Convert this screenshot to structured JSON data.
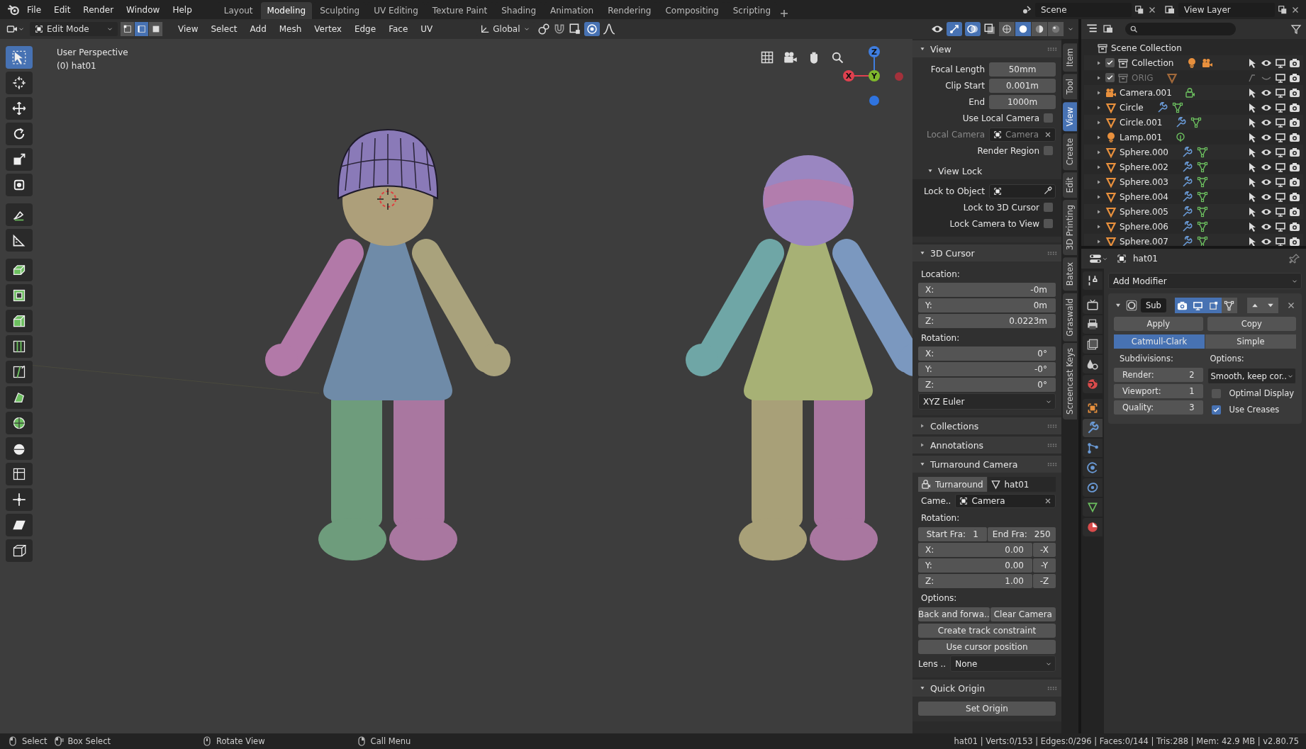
{
  "menubar": {
    "menus": [
      "File",
      "Edit",
      "Render",
      "Window",
      "Help"
    ],
    "workspaces": [
      {
        "label": "Layout",
        "selected": false
      },
      {
        "label": "Modeling",
        "selected": true
      },
      {
        "label": "Sculpting",
        "selected": false
      },
      {
        "label": "UV Editing",
        "selected": false
      },
      {
        "label": "Texture Paint",
        "selected": false
      },
      {
        "label": "Shading",
        "selected": false
      },
      {
        "label": "Animation",
        "selected": false
      },
      {
        "label": "Rendering",
        "selected": false
      },
      {
        "label": "Compositing",
        "selected": false
      },
      {
        "label": "Scripting",
        "selected": false
      }
    ],
    "scene": "Scene",
    "view_layer": "View Layer"
  },
  "header": {
    "mode": "Edit Mode",
    "select_modes": [
      {
        "selected": false
      },
      {
        "selected": true
      },
      {
        "selected": false
      }
    ],
    "menus": [
      "View",
      "Select",
      "Add",
      "Mesh",
      "Vertex",
      "Edge",
      "Face",
      "UV"
    ],
    "orientation": "Global",
    "shading": [
      {
        "selected": false
      },
      {
        "selected": true
      },
      {
        "selected": false
      },
      {
        "selected": false
      }
    ]
  },
  "viewport": {
    "view_name": "User Perspective",
    "object_info": "(0) hat01",
    "gizmo": [
      "Z",
      "X",
      "Y"
    ]
  },
  "toolbar": {
    "tools": [
      {
        "selected": true
      },
      {
        "selected": false
      },
      {
        "selected": false
      },
      {
        "selected": false
      },
      {
        "selected": false
      },
      {
        "selected": false
      },
      {
        "selected": false
      },
      {
        "selected": false
      },
      {
        "selected": false
      },
      {
        "selected": false
      },
      {
        "selected": false
      },
      {
        "selected": false
      },
      {
        "selected": false
      },
      {
        "selected": false
      },
      {
        "selected": false
      },
      {
        "selected": false
      },
      {
        "selected": false
      },
      {
        "selected": false
      },
      {
        "selected": false
      },
      {
        "selected": false
      }
    ]
  },
  "sidebar": {
    "tabs": [
      {
        "label": "Item",
        "selected": false
      },
      {
        "label": "Tool",
        "selected": false
      },
      {
        "label": "View",
        "selected": true
      },
      {
        "label": "Create",
        "selected": false
      },
      {
        "label": "Edit",
        "selected": false
      },
      {
        "label": "3D Printing",
        "selected": false
      },
      {
        "label": "Batex",
        "selected": false
      },
      {
        "label": "Graswald",
        "selected": false
      },
      {
        "label": "Screencast Keys",
        "selected": false
      }
    ],
    "panels": [
      {
        "title": "View",
        "expanded": true,
        "rows": [
          {
            "kind": "prop",
            "label": "Focal Length",
            "value": "50mm"
          },
          {
            "kind": "prop",
            "label": "Clip Start",
            "value": "0.001m"
          },
          {
            "kind": "prop",
            "label": "End",
            "value": "1000m"
          },
          {
            "kind": "check",
            "label": "Use Local Camera",
            "checked": false
          },
          {
            "kind": "object",
            "label": "Local Camera",
            "value": "Camera",
            "disabled": true
          },
          {
            "kind": "check",
            "label": "Render Region",
            "checked": false
          },
          {
            "kind": "subpanel",
            "title": "View Lock",
            "expanded": true,
            "rows": [
              {
                "kind": "picker",
                "label": "Lock to Object"
              },
              {
                "kind": "check",
                "label": "Lock to 3D Cursor",
                "checked": false
              },
              {
                "kind": "check",
                "label": "Lock Camera to View",
                "checked": false
              }
            ]
          }
        ]
      },
      {
        "title": "3D Cursor",
        "expanded": true,
        "rows": [
          {
            "kind": "caption",
            "text": "Location:"
          },
          {
            "kind": "vec",
            "label": "X:",
            "value": "-0m"
          },
          {
            "kind": "vec",
            "label": "Y:",
            "value": "0m"
          },
          {
            "kind": "vec",
            "label": "Z:",
            "value": "0.0223m"
          },
          {
            "kind": "caption",
            "text": "Rotation:"
          },
          {
            "kind": "vec",
            "label": "X:",
            "value": "0°"
          },
          {
            "kind": "vec",
            "label": "Y:",
            "value": "-0°"
          },
          {
            "kind": "vec",
            "label": "Z:",
            "value": "0°"
          },
          {
            "kind": "dropdown",
            "value": "XYZ Euler"
          }
        ]
      },
      {
        "title": "Collections",
        "expanded": false
      },
      {
        "title": "Annotations",
        "expanded": false
      },
      {
        "title": "Turnaround Camera",
        "expanded": true,
        "rows": [
          {
            "kind": "datablocks",
            "items": [
              {
                "label": "Turnaround",
                "selected": true
              },
              {
                "label": "hat01",
                "selected": false
              }
            ]
          },
          {
            "kind": "object",
            "label": "Came..",
            "value": "Camera",
            "disabled": false
          },
          {
            "kind": "caption",
            "text": "Rotation:"
          },
          {
            "kind": "framepair",
            "items": [
              {
                "label": "Start Fra:",
                "value": "1"
              },
              {
                "label": "End Fra:",
                "value": "250"
              }
            ]
          },
          {
            "kind": "vec",
            "label": "X:",
            "value": "0.00",
            "neg": "-X"
          },
          {
            "kind": "vec",
            "label": "Y:",
            "value": "0.00",
            "neg": "-Y"
          },
          {
            "kind": "vec",
            "label": "Z:",
            "value": "1.00",
            "neg": "-Z"
          },
          {
            "kind": "caption",
            "text": "Options:"
          },
          {
            "kind": "pair",
            "items": [
              "Back and forwa..",
              "Clear Camera"
            ]
          },
          {
            "kind": "button",
            "label": "Create track constraint"
          },
          {
            "kind": "button",
            "label": "Use cursor position"
          },
          {
            "kind": "dropdown",
            "label": "Lens ..",
            "value": "None"
          }
        ]
      },
      {
        "title": "Quick Origin",
        "expanded": true,
        "rows": [
          {
            "kind": "button",
            "label": "Set Origin"
          }
        ]
      }
    ]
  },
  "outliner": {
    "root": {
      "name": "Scene Collection",
      "children": [
        {
          "kind": "collection",
          "name": "Collection",
          "checked": true,
          "disabled": false,
          "badges": [
            {
              "kind": "lamp"
            },
            {
              "kind": "camera"
            }
          ]
        },
        {
          "kind": "collection",
          "name": "ORIG",
          "checked": true,
          "disabled": true,
          "badges": [
            {
              "kind": "mesh"
            }
          ]
        },
        {
          "kind": "camera",
          "name": "Camera.001",
          "disabled": false,
          "badges": [
            {
              "kind": "camera-data"
            }
          ]
        },
        {
          "kind": "mesh",
          "name": "Circle",
          "disabled": false,
          "badges": [
            {
              "kind": "wrench"
            },
            {
              "kind": "mesh-data"
            }
          ]
        },
        {
          "kind": "mesh",
          "name": "Circle.001",
          "disabled": false,
          "badges": [
            {
              "kind": "wrench"
            },
            {
              "kind": "mesh-data"
            }
          ]
        },
        {
          "kind": "lamp",
          "name": "Lamp.001",
          "disabled": false,
          "badges": [
            {
              "kind": "lamp-data"
            }
          ]
        },
        {
          "kind": "mesh",
          "name": "Sphere.000",
          "disabled": false,
          "badges": [
            {
              "kind": "wrench"
            },
            {
              "kind": "mesh-data"
            }
          ]
        },
        {
          "kind": "mesh",
          "name": "Sphere.002",
          "disabled": false,
          "badges": [
            {
              "kind": "wrench"
            },
            {
              "kind": "mesh-data"
            }
          ]
        },
        {
          "kind": "mesh",
          "name": "Sphere.003",
          "disabled": false,
          "badges": [
            {
              "kind": "wrench"
            },
            {
              "kind": "mesh-data"
            }
          ]
        },
        {
          "kind": "mesh",
          "name": "Sphere.004",
          "disabled": false,
          "badges": [
            {
              "kind": "wrench"
            },
            {
              "kind": "mesh-data"
            }
          ]
        },
        {
          "kind": "mesh",
          "name": "Sphere.005",
          "disabled": false,
          "badges": [
            {
              "kind": "wrench"
            },
            {
              "kind": "mesh-data"
            }
          ]
        },
        {
          "kind": "mesh",
          "name": "Sphere.006",
          "disabled": false,
          "badges": [
            {
              "kind": "wrench"
            },
            {
              "kind": "mesh-data"
            }
          ]
        },
        {
          "kind": "mesh",
          "name": "Sphere.007",
          "disabled": false,
          "badges": [
            {
              "kind": "wrench"
            },
            {
              "kind": "mesh-data"
            }
          ]
        }
      ]
    }
  },
  "properties": {
    "tabs": [
      {
        "selected": false
      },
      {
        "selected": false
      },
      {
        "selected": false
      },
      {
        "selected": false
      },
      {
        "selected": false
      },
      {
        "selected": false
      },
      {
        "selected": false
      },
      {
        "selected": true
      },
      {
        "selected": false
      },
      {
        "selected": false
      },
      {
        "selected": false
      },
      {
        "selected": false
      },
      {
        "selected": false
      }
    ],
    "object": "hat01",
    "add_modifier": "Add Modifier",
    "modifier": {
      "name": "Sub",
      "expanded": true,
      "toggles": [
        {
          "on": true
        },
        {
          "on": true
        },
        {
          "on": true
        },
        {
          "on": false
        }
      ],
      "apply": "Apply",
      "copy": "Copy",
      "types": [
        {
          "label": "Catmull-Clark",
          "selected": true
        },
        {
          "label": "Simple",
          "selected": false
        }
      ],
      "subdivisions_label": "Subdivisions:",
      "levels": [
        {
          "label": "Render:",
          "value": "2"
        },
        {
          "label": "Viewport:",
          "value": "1"
        },
        {
          "label": "Quality:",
          "value": "3"
        }
      ],
      "options_label": "Options:",
      "uv_smooth": "Smooth, keep cor..",
      "checks": [
        {
          "label": "Optimal Display",
          "checked": false
        },
        {
          "label": "Use Creases",
          "checked": true
        }
      ]
    }
  },
  "status_bar": {
    "hints": [
      {
        "kind": "left",
        "label": "Select"
      },
      {
        "kind": "left-drag",
        "label": "Box Select"
      },
      {
        "kind": "middle",
        "label": "Rotate View"
      },
      {
        "kind": "right",
        "label": "Call Menu"
      }
    ],
    "stats": "hat01 | Verts:0/153 | Edges:0/296 | Faces:0/144 | Tris:288 | Mem: 42.9 MB | v2.80.75"
  }
}
